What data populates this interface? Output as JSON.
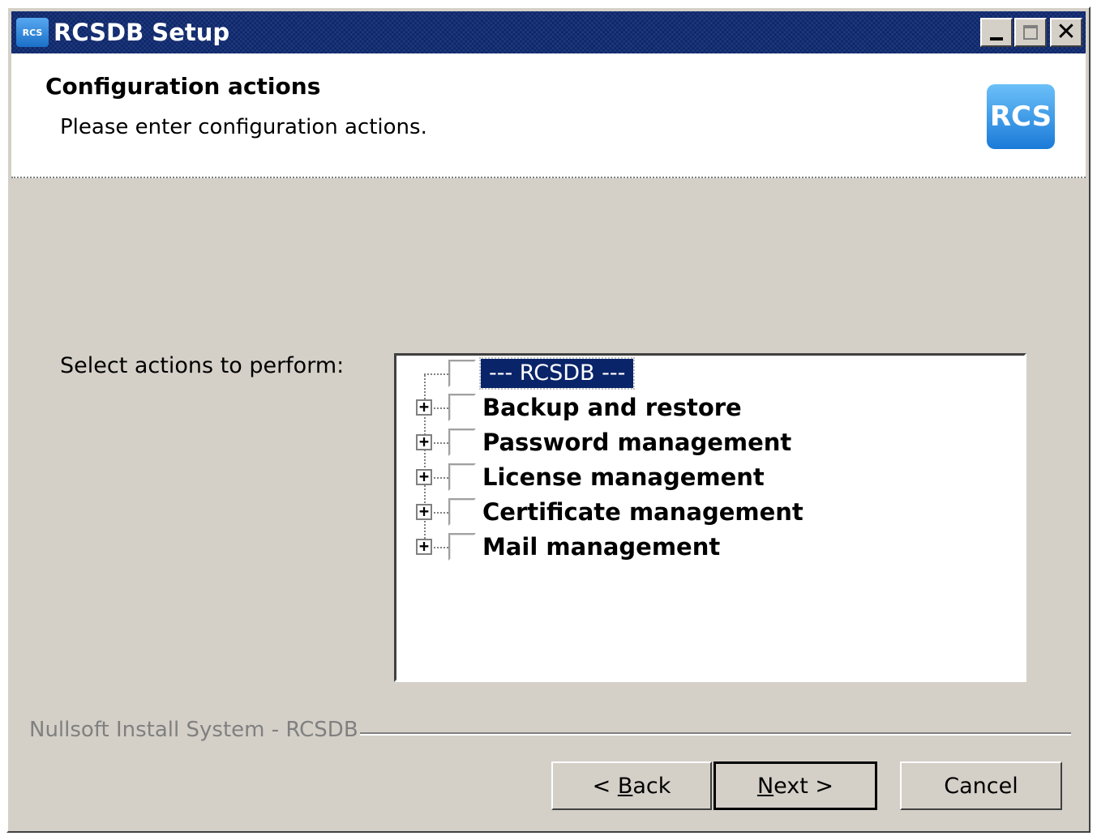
{
  "window": {
    "title": "RCSDB Setup",
    "icon_text": "RCS",
    "controls": {
      "minimize": "minimize",
      "maximize": "maximize",
      "close": "✕"
    }
  },
  "header": {
    "title": "Configuration actions",
    "subtitle": "Please enter configuration actions.",
    "logo_text": "RCS"
  },
  "content": {
    "select_label": "Select actions to perform:",
    "tree": {
      "root_label": "--- RCSDB ---",
      "items": [
        {
          "label": "Backup and restore",
          "expander": "+",
          "checked": false
        },
        {
          "label": "Password management",
          "expander": "+",
          "checked": false
        },
        {
          "label": "License management",
          "expander": "+",
          "checked": false
        },
        {
          "label": "Certificate management",
          "expander": "+",
          "checked": false
        },
        {
          "label": "Mail management",
          "expander": "+",
          "checked": false
        }
      ]
    }
  },
  "footer": {
    "brand": "Nullsoft Install System - RCSDB",
    "buttons": {
      "back_prefix": "< ",
      "back_key": "B",
      "back_rest": "ack",
      "next_key": "N",
      "next_rest": "ext >",
      "cancel": "Cancel"
    }
  },
  "colors": {
    "titlebar": "#0a246a",
    "window_face": "#d4d0c8",
    "selection": "#0a246a"
  }
}
